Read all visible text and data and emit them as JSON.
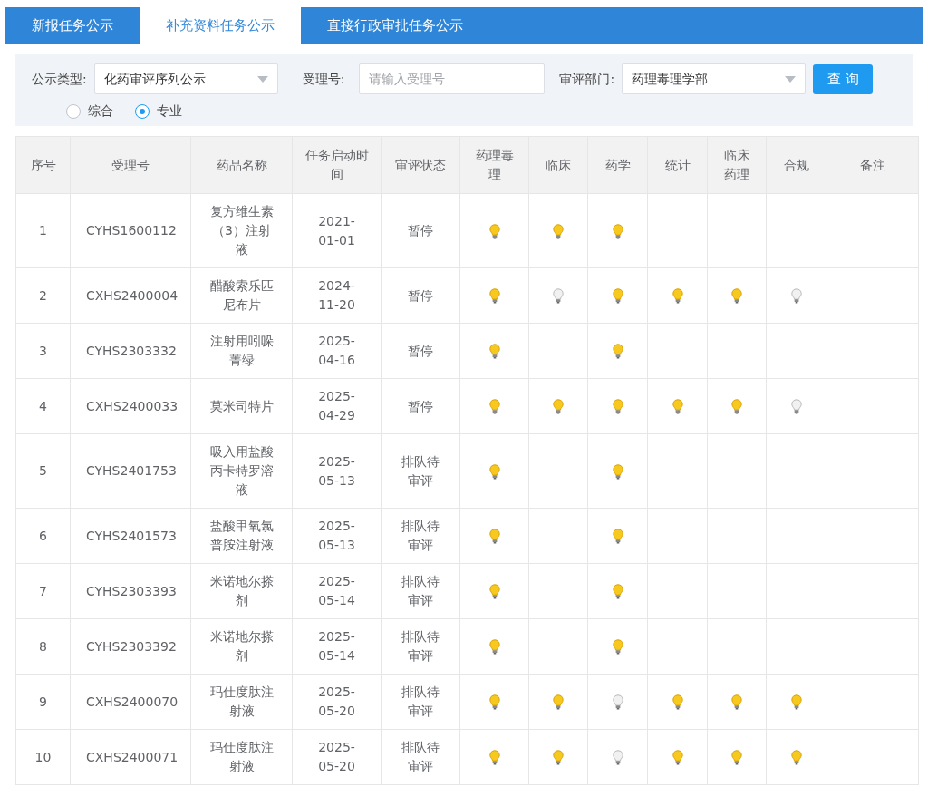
{
  "tabs": [
    {
      "label": "新报任务公示",
      "selected": false
    },
    {
      "label": "补充资料任务公示",
      "selected": true
    },
    {
      "label": "直接行政审批任务公示",
      "selected": false
    }
  ],
  "filters": {
    "type_label": "公示类型:",
    "type_value": "化药审评序列公示",
    "number_label": "受理号:",
    "number_placeholder": "请输入受理号",
    "dept_label": "审评部门:",
    "dept_value": "药理毒理学部",
    "query_button": "查 询",
    "radios": [
      {
        "label": "综合",
        "selected": false
      },
      {
        "label": "专业",
        "selected": true
      }
    ]
  },
  "table": {
    "columns": [
      "序号",
      "受理号",
      "药品名称",
      "任务启动时间",
      "审评状态",
      "药理毒理",
      "临床",
      "药学",
      "统计",
      "临床药理",
      "合规",
      "备注"
    ],
    "rows": [
      {
        "no": "1",
        "number": "CYHS1600112",
        "name": "复方维生素（3）注射液",
        "date": "2021-01-01",
        "status": "暂停",
        "cells": [
          {
            "kind": "bulb",
            "lit": true
          },
          {
            "kind": "bulb",
            "lit": true
          },
          {
            "kind": "bulb",
            "lit": true
          },
          {
            "kind": "empty"
          },
          {
            "kind": "empty"
          },
          {
            "kind": "empty"
          }
        ]
      },
      {
        "no": "2",
        "number": "CXHS2400004",
        "name": "醋酸索乐匹尼布片",
        "date": "2024-11-20",
        "status": "暂停",
        "cells": [
          {
            "kind": "bulb",
            "lit": true
          },
          {
            "kind": "bulb",
            "lit": false
          },
          {
            "kind": "bulb",
            "lit": true
          },
          {
            "kind": "bulb",
            "lit": true
          },
          {
            "kind": "bulb",
            "lit": true
          },
          {
            "kind": "bulb",
            "lit": false
          }
        ]
      },
      {
        "no": "3",
        "number": "CYHS2303332",
        "name": "注射用吲哚菁绿",
        "date": "2025-04-16",
        "status": "暂停",
        "cells": [
          {
            "kind": "bulb",
            "lit": true
          },
          {
            "kind": "empty"
          },
          {
            "kind": "bulb",
            "lit": true
          },
          {
            "kind": "empty"
          },
          {
            "kind": "empty"
          },
          {
            "kind": "empty"
          }
        ]
      },
      {
        "no": "4",
        "number": "CXHS2400033",
        "name": "莫米司特片",
        "date": "2025-04-29",
        "status": "暂停",
        "cells": [
          {
            "kind": "bulb",
            "lit": true
          },
          {
            "kind": "bulb",
            "lit": true
          },
          {
            "kind": "bulb",
            "lit": true
          },
          {
            "kind": "bulb",
            "lit": true
          },
          {
            "kind": "bulb",
            "lit": true
          },
          {
            "kind": "bulb",
            "lit": false
          }
        ]
      },
      {
        "no": "5",
        "number": "CYHS2401753",
        "name": "吸入用盐酸丙卡特罗溶液",
        "date": "2025-05-13",
        "status": "排队待审评",
        "cells": [
          {
            "kind": "bulb",
            "lit": true
          },
          {
            "kind": "empty"
          },
          {
            "kind": "bulb",
            "lit": true
          },
          {
            "kind": "empty"
          },
          {
            "kind": "empty"
          },
          {
            "kind": "empty"
          }
        ]
      },
      {
        "no": "6",
        "number": "CYHS2401573",
        "name": "盐酸甲氧氯普胺注射液",
        "date": "2025-05-13",
        "status": "排队待审评",
        "cells": [
          {
            "kind": "bulb",
            "lit": true
          },
          {
            "kind": "empty"
          },
          {
            "kind": "bulb",
            "lit": true
          },
          {
            "kind": "empty"
          },
          {
            "kind": "empty"
          },
          {
            "kind": "empty"
          }
        ]
      },
      {
        "no": "7",
        "number": "CYHS2303393",
        "name": "米诺地尔搽剂",
        "date": "2025-05-14",
        "status": "排队待审评",
        "cells": [
          {
            "kind": "bulb",
            "lit": true
          },
          {
            "kind": "empty"
          },
          {
            "kind": "bulb",
            "lit": true
          },
          {
            "kind": "empty"
          },
          {
            "kind": "empty"
          },
          {
            "kind": "empty"
          }
        ]
      },
      {
        "no": "8",
        "number": "CYHS2303392",
        "name": "米诺地尔搽剂",
        "date": "2025-05-14",
        "status": "排队待审评",
        "cells": [
          {
            "kind": "bulb",
            "lit": true
          },
          {
            "kind": "empty"
          },
          {
            "kind": "bulb",
            "lit": true
          },
          {
            "kind": "empty"
          },
          {
            "kind": "empty"
          },
          {
            "kind": "empty"
          }
        ]
      },
      {
        "no": "9",
        "number": "CXHS2400070",
        "name": "玛仕度肽注射液",
        "date": "2025-05-20",
        "status": "排队待审评",
        "cells": [
          {
            "kind": "bulb",
            "lit": true
          },
          {
            "kind": "bulb",
            "lit": true
          },
          {
            "kind": "bulb",
            "lit": false
          },
          {
            "kind": "bulb",
            "lit": true
          },
          {
            "kind": "bulb",
            "lit": true
          },
          {
            "kind": "bulb",
            "lit": true
          }
        ]
      },
      {
        "no": "10",
        "number": "CXHS2400071",
        "name": "玛仕度肽注射液",
        "date": "2025-05-20",
        "status": "排队待审评",
        "cells": [
          {
            "kind": "bulb",
            "lit": true
          },
          {
            "kind": "bulb",
            "lit": true
          },
          {
            "kind": "bulb",
            "lit": false
          },
          {
            "kind": "bulb",
            "lit": true
          },
          {
            "kind": "bulb",
            "lit": true
          },
          {
            "kind": "bulb",
            "lit": true
          }
        ]
      }
    ]
  }
}
